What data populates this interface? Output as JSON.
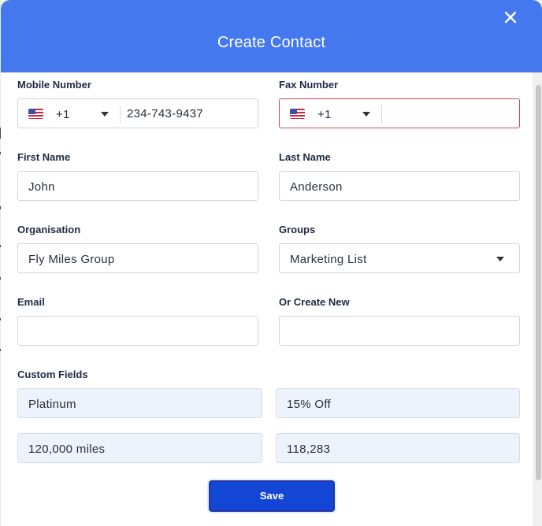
{
  "dialog": {
    "title": "Create Contact",
    "close_icon": "close-icon",
    "accent_color": "#4378ee"
  },
  "form": {
    "mobile": {
      "label": "Mobile Number",
      "flag_icon": "us-flag-icon",
      "country_code": "+1",
      "value": "234-743-9437"
    },
    "fax": {
      "label": "Fax Number",
      "flag_icon": "us-flag-icon",
      "country_code": "+1",
      "value": "",
      "status_color": "#d8474d"
    },
    "first_name": {
      "label": "First Name",
      "value": "John"
    },
    "last_name": {
      "label": "Last Name",
      "value": "Anderson"
    },
    "organisation": {
      "label": "Organisation",
      "value": "Fly Miles Group"
    },
    "groups": {
      "label": "Groups",
      "selected": "Marketing List"
    },
    "email": {
      "label": "Email",
      "value": ""
    },
    "create_new": {
      "label": "Or Create New",
      "value": ""
    },
    "custom_fields": {
      "label": "Custom Fields",
      "values": [
        "Platinum",
        "15% Off",
        "120,000 miles",
        "118,283"
      ]
    }
  },
  "actions": {
    "save_label": "Save",
    "save_color": "#1446d6"
  }
}
